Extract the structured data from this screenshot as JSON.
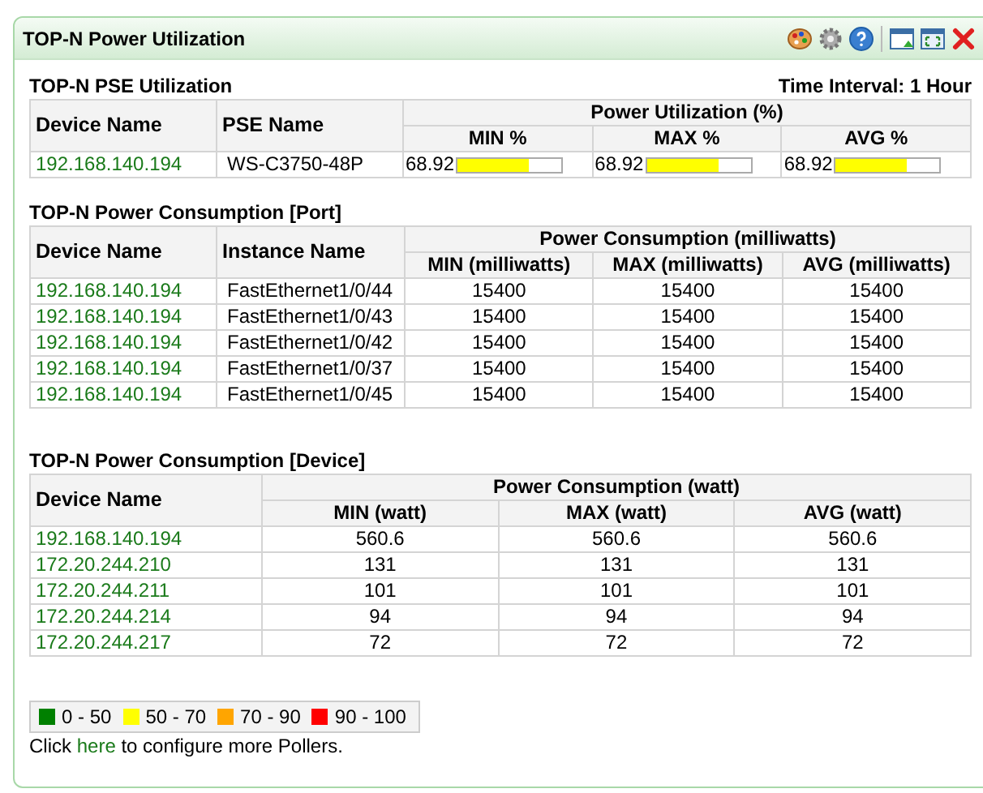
{
  "window": {
    "title": "TOP-N Power Utilization"
  },
  "pse": {
    "title": "TOP-N PSE Utilization",
    "time_interval": "Time Interval: 1 Hour",
    "columns": [
      "Device Name",
      "PSE Name"
    ],
    "group": "Power Utilization (%)",
    "subcolumns": [
      "MIN %",
      "MAX %",
      "AVG %"
    ],
    "rows": [
      {
        "device": "192.168.140.194",
        "pse": "WS-C3750-48P",
        "values": [
          {
            "value": "68.92",
            "level": 0.6892,
            "color": "#ffff00"
          },
          {
            "value": "68.92",
            "level": 0.6892,
            "color": "#ffff00"
          },
          {
            "value": "68.92",
            "level": 0.6892,
            "color": "#ffff00"
          }
        ]
      }
    ]
  },
  "port": {
    "title": "TOP-N Power Consumption [Port]",
    "columns": [
      "Device Name",
      "Instance Name"
    ],
    "group": "Power Consumption (milliwatts)",
    "subcolumns": [
      "MIN (milliwatts)",
      "MAX (milliwatts)",
      "AVG (milliwatts)"
    ],
    "rows": [
      {
        "device": "192.168.140.194",
        "instance": "FastEthernet1/0/44",
        "values": [
          "15400",
          "15400",
          "15400"
        ]
      },
      {
        "device": "192.168.140.194",
        "instance": "FastEthernet1/0/43",
        "values": [
          "15400",
          "15400",
          "15400"
        ]
      },
      {
        "device": "192.168.140.194",
        "instance": "FastEthernet1/0/42",
        "values": [
          "15400",
          "15400",
          "15400"
        ]
      },
      {
        "device": "192.168.140.194",
        "instance": "FastEthernet1/0/37",
        "values": [
          "15400",
          "15400",
          "15400"
        ]
      },
      {
        "device": "192.168.140.194",
        "instance": "FastEthernet1/0/45",
        "values": [
          "15400",
          "15400",
          "15400"
        ]
      }
    ]
  },
  "device": {
    "title": "TOP-N Power Consumption [Device]",
    "columns": [
      "Device Name"
    ],
    "group": "Power Consumption (watt)",
    "subcolumns": [
      "MIN (watt)",
      "MAX (watt)",
      "AVG (watt)"
    ],
    "rows": [
      {
        "device": "192.168.140.194",
        "values": [
          "560.6",
          "560.6",
          "560.6"
        ]
      },
      {
        "device": "172.20.244.210",
        "values": [
          "131",
          "131",
          "131"
        ]
      },
      {
        "device": "172.20.244.211",
        "values": [
          "101",
          "101",
          "101"
        ]
      },
      {
        "device": "172.20.244.214",
        "values": [
          "94",
          "94",
          "94"
        ]
      },
      {
        "device": "172.20.244.217",
        "values": [
          "72",
          "72",
          "72"
        ]
      }
    ]
  },
  "legend": [
    {
      "label": "0 - 50",
      "color": "#008000"
    },
    {
      "label": "50 - 70",
      "color": "#ffff00"
    },
    {
      "label": "70 - 90",
      "color": "#ffa500"
    },
    {
      "label": "90 - 100",
      "color": "#ff0000"
    }
  ],
  "footer": {
    "before": "Click",
    "link": "here",
    "after": "to configure more Pollers."
  }
}
